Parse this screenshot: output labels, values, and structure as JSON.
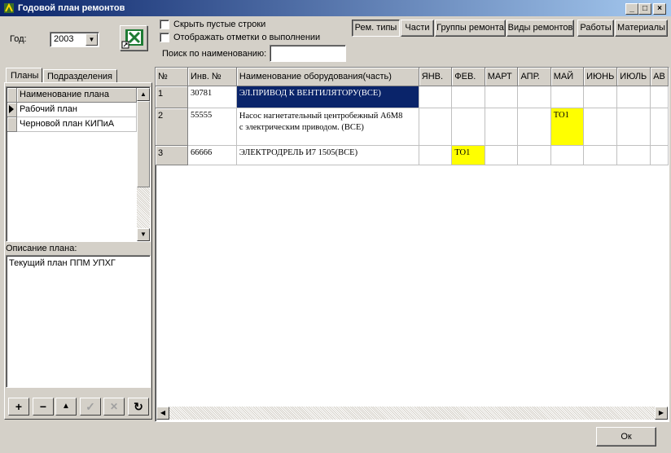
{
  "window": {
    "title": "Годовой план ремонтов",
    "minimize": "_",
    "maximize": "□",
    "close": "×"
  },
  "year": {
    "label": "Год:",
    "value": "2003"
  },
  "options": {
    "hide_empty": "Скрыть пустые строки",
    "show_marks": "Отображать отметки о выполнении",
    "search_label": "Поиск по наименованию:",
    "search_value": ""
  },
  "toolbar": {
    "rem_types": "Рем. типы",
    "parts": "Части",
    "repair_groups": "Группы ремонта",
    "repair_kinds": "Виды ремонтов",
    "works": "Работы",
    "materials": "Материалы"
  },
  "tabs": {
    "plans": "Планы",
    "departments": "Подразделения"
  },
  "plans_table": {
    "header": "Наименование плана",
    "rows": [
      "Рабочий план",
      "Черновой план КИПиА"
    ]
  },
  "plan_description": {
    "label": "Описание плана:",
    "text": "Текущий план ППМ УПХГ"
  },
  "nav_buttons": {
    "add": "+",
    "delete": "−",
    "up": "▲",
    "post": "✓",
    "cancel": "✕",
    "refresh": "↻"
  },
  "grid": {
    "headers": [
      "№",
      "Инв. №",
      "Наименование оборудования(часть)",
      "ЯНВ.",
      "ФЕВ.",
      "МАРТ",
      "АПР.",
      "МАЙ",
      "ИЮНЬ",
      "ИЮЛЬ",
      "АВ"
    ],
    "rows": [
      {
        "num": "1",
        "inv": "30781",
        "name": "ЭЛ.ПРИВОД К ВЕНТИЛЯТОРУ(ВСЕ)",
        "name2": "",
        "feb": "",
        "may": ""
      },
      {
        "num": "2",
        "inv": "55555",
        "name": "Насос нагнетательный центробежный А6М8",
        "name2": "с электрическим приводом. (ВСЕ)",
        "feb": "",
        "may": "ТО1"
      },
      {
        "num": "3",
        "inv": "66666",
        "name": "ЭЛЕКТРОДРЕЛЬ И7 1505(ВСЕ)",
        "name2": "",
        "feb": "ТО1",
        "may": ""
      }
    ]
  },
  "ok_button": "Ок",
  "colors": {
    "title_start": "#0a246a",
    "title_end": "#a6caf0",
    "selection": "#0a246a",
    "highlight": "#ffff00",
    "face": "#d4d0c8"
  }
}
